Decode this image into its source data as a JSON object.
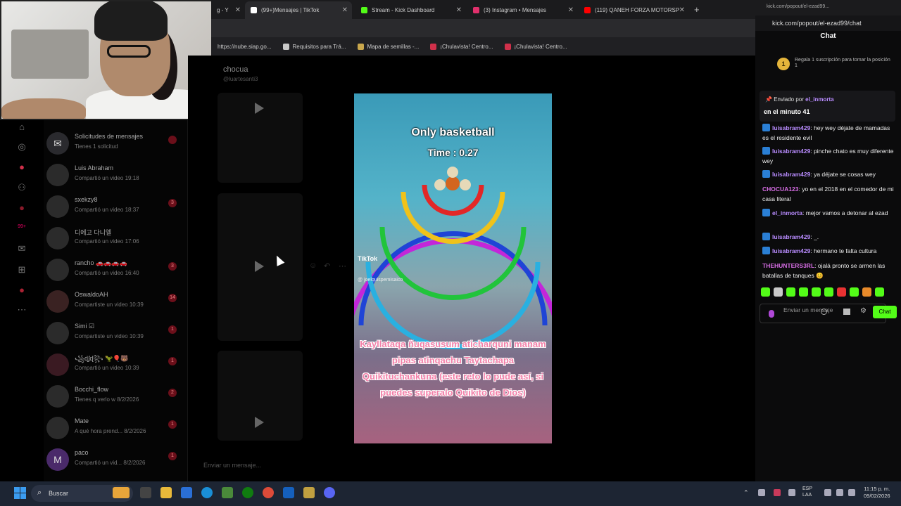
{
  "browser": {
    "tabs": [
      {
        "label": "g - Y",
        "icon_color": "#555555"
      },
      {
        "label": "(99+)Mensajes | TikTok",
        "icon_color": "#ffffff"
      },
      {
        "label": "Stream - Kick Dashboard",
        "icon_color": "#53fc18"
      },
      {
        "label": "(3) Instagram • Mensajes",
        "icon_color": "#e1306c"
      },
      {
        "label": "(119) QANEH FORZA MOTORSP",
        "icon_color": "#ff0000"
      }
    ],
    "bookmarks": [
      {
        "label": "https://nube.siap.go...",
        "icon_color": "#5a6a8a"
      },
      {
        "label": "Requisitos para Trá...",
        "icon_color": "#c9c9c9"
      },
      {
        "label": "Mapa de semillas -...",
        "icon_color": "#c9a74c"
      },
      {
        "label": "¡Chulavista! Centro...",
        "icon_color": "#d0304a"
      },
      {
        "label": "¡Chulavista! Centro...",
        "icon_color": "#d0304a"
      }
    ]
  },
  "nav": {
    "icons": [
      "home-icon",
      "compass-icon",
      "live-icon",
      "friends-icon",
      "upload-icon",
      "messages-icon",
      "inbox-icon",
      "add-icon",
      "profile-icon",
      "more-icon"
    ],
    "messages_badge": "99+"
  },
  "threads": [
    {
      "name": "Solicitudes de mensajes",
      "sub": "Tienes 1 solicitud",
      "badge": ""
    },
    {
      "name": "Luis Abraham",
      "sub": "Compartió un video  19:18",
      "badge": ""
    },
    {
      "name": "sxekzy8",
      "sub": "Compartió un video  18:37",
      "badge": "3"
    },
    {
      "name": "디에고 다니엘",
      "sub": "Compartió un video  17:06",
      "badge": ""
    },
    {
      "name": "rancho 🚗🚗🚗🚗",
      "sub": "Compartió un video  16:40",
      "badge": "3"
    },
    {
      "name": "OswaldoAH",
      "sub": "Compartiste un video  10:39",
      "badge": "14"
    },
    {
      "name": "Simi ☑",
      "sub": "Compartiste un video  10:39",
      "badge": "1"
    },
    {
      "name": "꧁ɖʄɖ꧂ 🦖🎈🐻",
      "sub": "Compartió un video  10:39",
      "badge": "1"
    },
    {
      "name": "Bocchi_flow",
      "sub": "Tienes q verlo w  8/2/2026",
      "badge": "2"
    },
    {
      "name": "Mate",
      "sub": "A qué hora prend...  8/2/2026",
      "badge": "1"
    },
    {
      "name": "paco",
      "sub": "Compartió un vid...  8/2/2026",
      "badge": "1",
      "initial": "M"
    }
  ],
  "conversation": {
    "title": "chocua",
    "handle": "@luartesanti3",
    "composer_placeholder": "Enviar un mensaje..."
  },
  "video": {
    "title": "Only basketball",
    "timer": "Time : 0.27",
    "watermark": "TikTok",
    "username": "@ joelquispemisaico",
    "caption": "Kayllataqa ñuqasusum aticharquni manam pipas atinqachu Taytachapa Quikituchankuna (este reto lo pude así, si puedes superalo Quikito de Dios)"
  },
  "chat": {
    "window_url": "kick.com/popout/el-ezad99...",
    "url": "kick.com/popout/el-ezad99/chat",
    "header": "Chat",
    "promo_rank": "1",
    "promo": "Regala 1 suscripción para tomar la posición 1",
    "pinned_by_prefix": "Enviado por",
    "pinned_user": "el_inmorta",
    "pinned_text": "en el minuto 41",
    "messages": [
      {
        "user": "luisabram429",
        "text": ": hey wey déjate de mamadas es el residente evil",
        "badge": true,
        "style": "purple"
      },
      {
        "user": "luisabram429",
        "text": ": pinche chato es muy diferente wey",
        "badge": true,
        "style": "purple"
      },
      {
        "user": "luisabram429",
        "text": ": ya déjate se cosas wey",
        "badge": true,
        "style": "purple"
      },
      {
        "user": "CHOCUA123",
        "text": ": yo en el 2018 en el comedor de mi casa literal",
        "badge": false,
        "style": "pink"
      },
      {
        "user": "el_inmorta",
        "text": ": mejor vamos a detonar al ezad",
        "badge": true,
        "style": "purple"
      },
      {
        "user": "luisabram429",
        "text": ": _.",
        "badge": true,
        "style": "purple"
      },
      {
        "user": "luisabram429",
        "text": ": hermano te falta cultura",
        "badge": true,
        "style": "purple"
      },
      {
        "user": "THEHUNTERS3RL",
        "text": ": ojalá pronto se armen las batallas de tanques 😊",
        "badge": false,
        "style": "pink"
      }
    ],
    "input_placeholder": "Enviar un mensaje",
    "send_label": "Chat",
    "accent": "#53fc18"
  },
  "taskbar": {
    "search_placeholder": "Buscar",
    "lang_top": "ESP",
    "lang_bottom": "LAA",
    "time": "11:15 p. m.",
    "date": "09/02/2026"
  }
}
